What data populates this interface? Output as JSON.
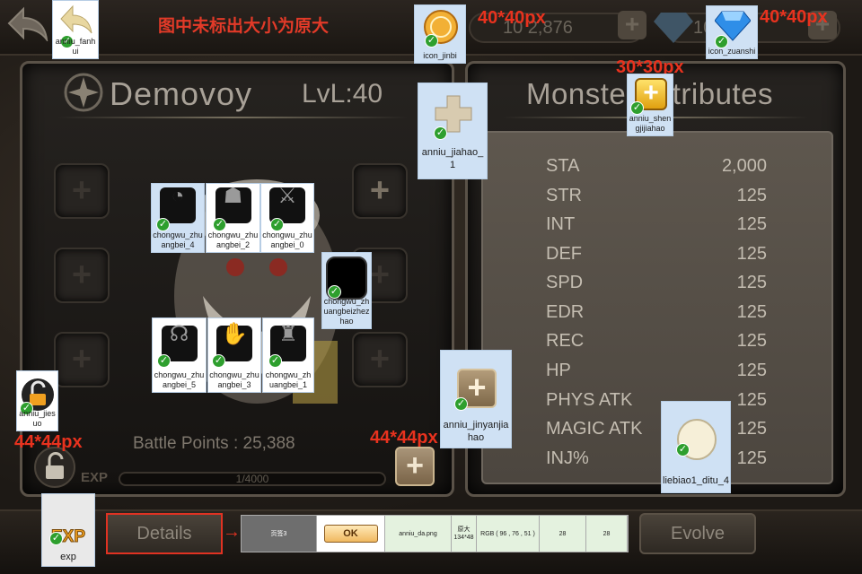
{
  "notice": "图中未标出大小为原大",
  "size_labels": {
    "top_coin": "40*40px",
    "top_gem": "40*40px",
    "plus_small": "30*30px",
    "lock": "44*44px",
    "plus_big": "44*44px"
  },
  "header": {
    "gold_value": "10 2,876",
    "gem_value": "10 527"
  },
  "monster": {
    "name": "Demovoy",
    "level": "LvL:40",
    "battle_points": "Battle Points : 25,388",
    "exp_label": "EXP",
    "exp_text": "1/4000"
  },
  "attributes": {
    "title": "Monster Attributes",
    "rows": [
      {
        "key": "STA",
        "value": "2,000"
      },
      {
        "key": "STR",
        "value": "125"
      },
      {
        "key": "INT",
        "value": "125"
      },
      {
        "key": "DEF",
        "value": "125"
      },
      {
        "key": "SPD",
        "value": "125"
      },
      {
        "key": "EDR",
        "value": "125"
      },
      {
        "key": "REC",
        "value": "125"
      },
      {
        "key": "HP",
        "value": "125"
      },
      {
        "key": "PHYS ATK",
        "value": "125"
      },
      {
        "key": "MAGIC ATK",
        "value": "125"
      },
      {
        "key": "INJ%",
        "value": "125"
      }
    ]
  },
  "assets": {
    "back": "anniu_fanhui",
    "coin": "icon_jinbi",
    "gem": "icon_zuanshi",
    "plus_small": "anniu_shengjijiahao",
    "plus_panel": "anniu_jiahao_1",
    "equip_4": "chongwu_zhuangbei_4",
    "equip_2": "chongwu_zhuangbei_2",
    "equip_0": "chongwu_zhuangbei_0",
    "equip_frame": "chongwu_zhuangbeizhezhao",
    "equip_5": "chongwu_zhuangbei_5",
    "equip_3": "chongwu_zhuangbei_3",
    "equip_1": "chongwu_zhuangbei_1",
    "lock": "anniu_jiesuo",
    "plus_exp": "anniu_jinyanjiahao",
    "map_circle": "liebiao1_ditu_4",
    "exp_badge": "exp"
  },
  "buttons": {
    "details": "Details",
    "evolve": "Evolve",
    "arrow": "→"
  },
  "spec": {
    "tab": "页签3",
    "ok": "OK",
    "file": "anniu_da.png",
    "size": "原大 134*48",
    "rgb": "RGB ( 96 , 76 , 51 )",
    "v1": "28",
    "v2": "28"
  },
  "colors": {
    "accent_red": "#e8321e",
    "panel_border": "#5a5248",
    "check_green": "#2e9f2e"
  }
}
